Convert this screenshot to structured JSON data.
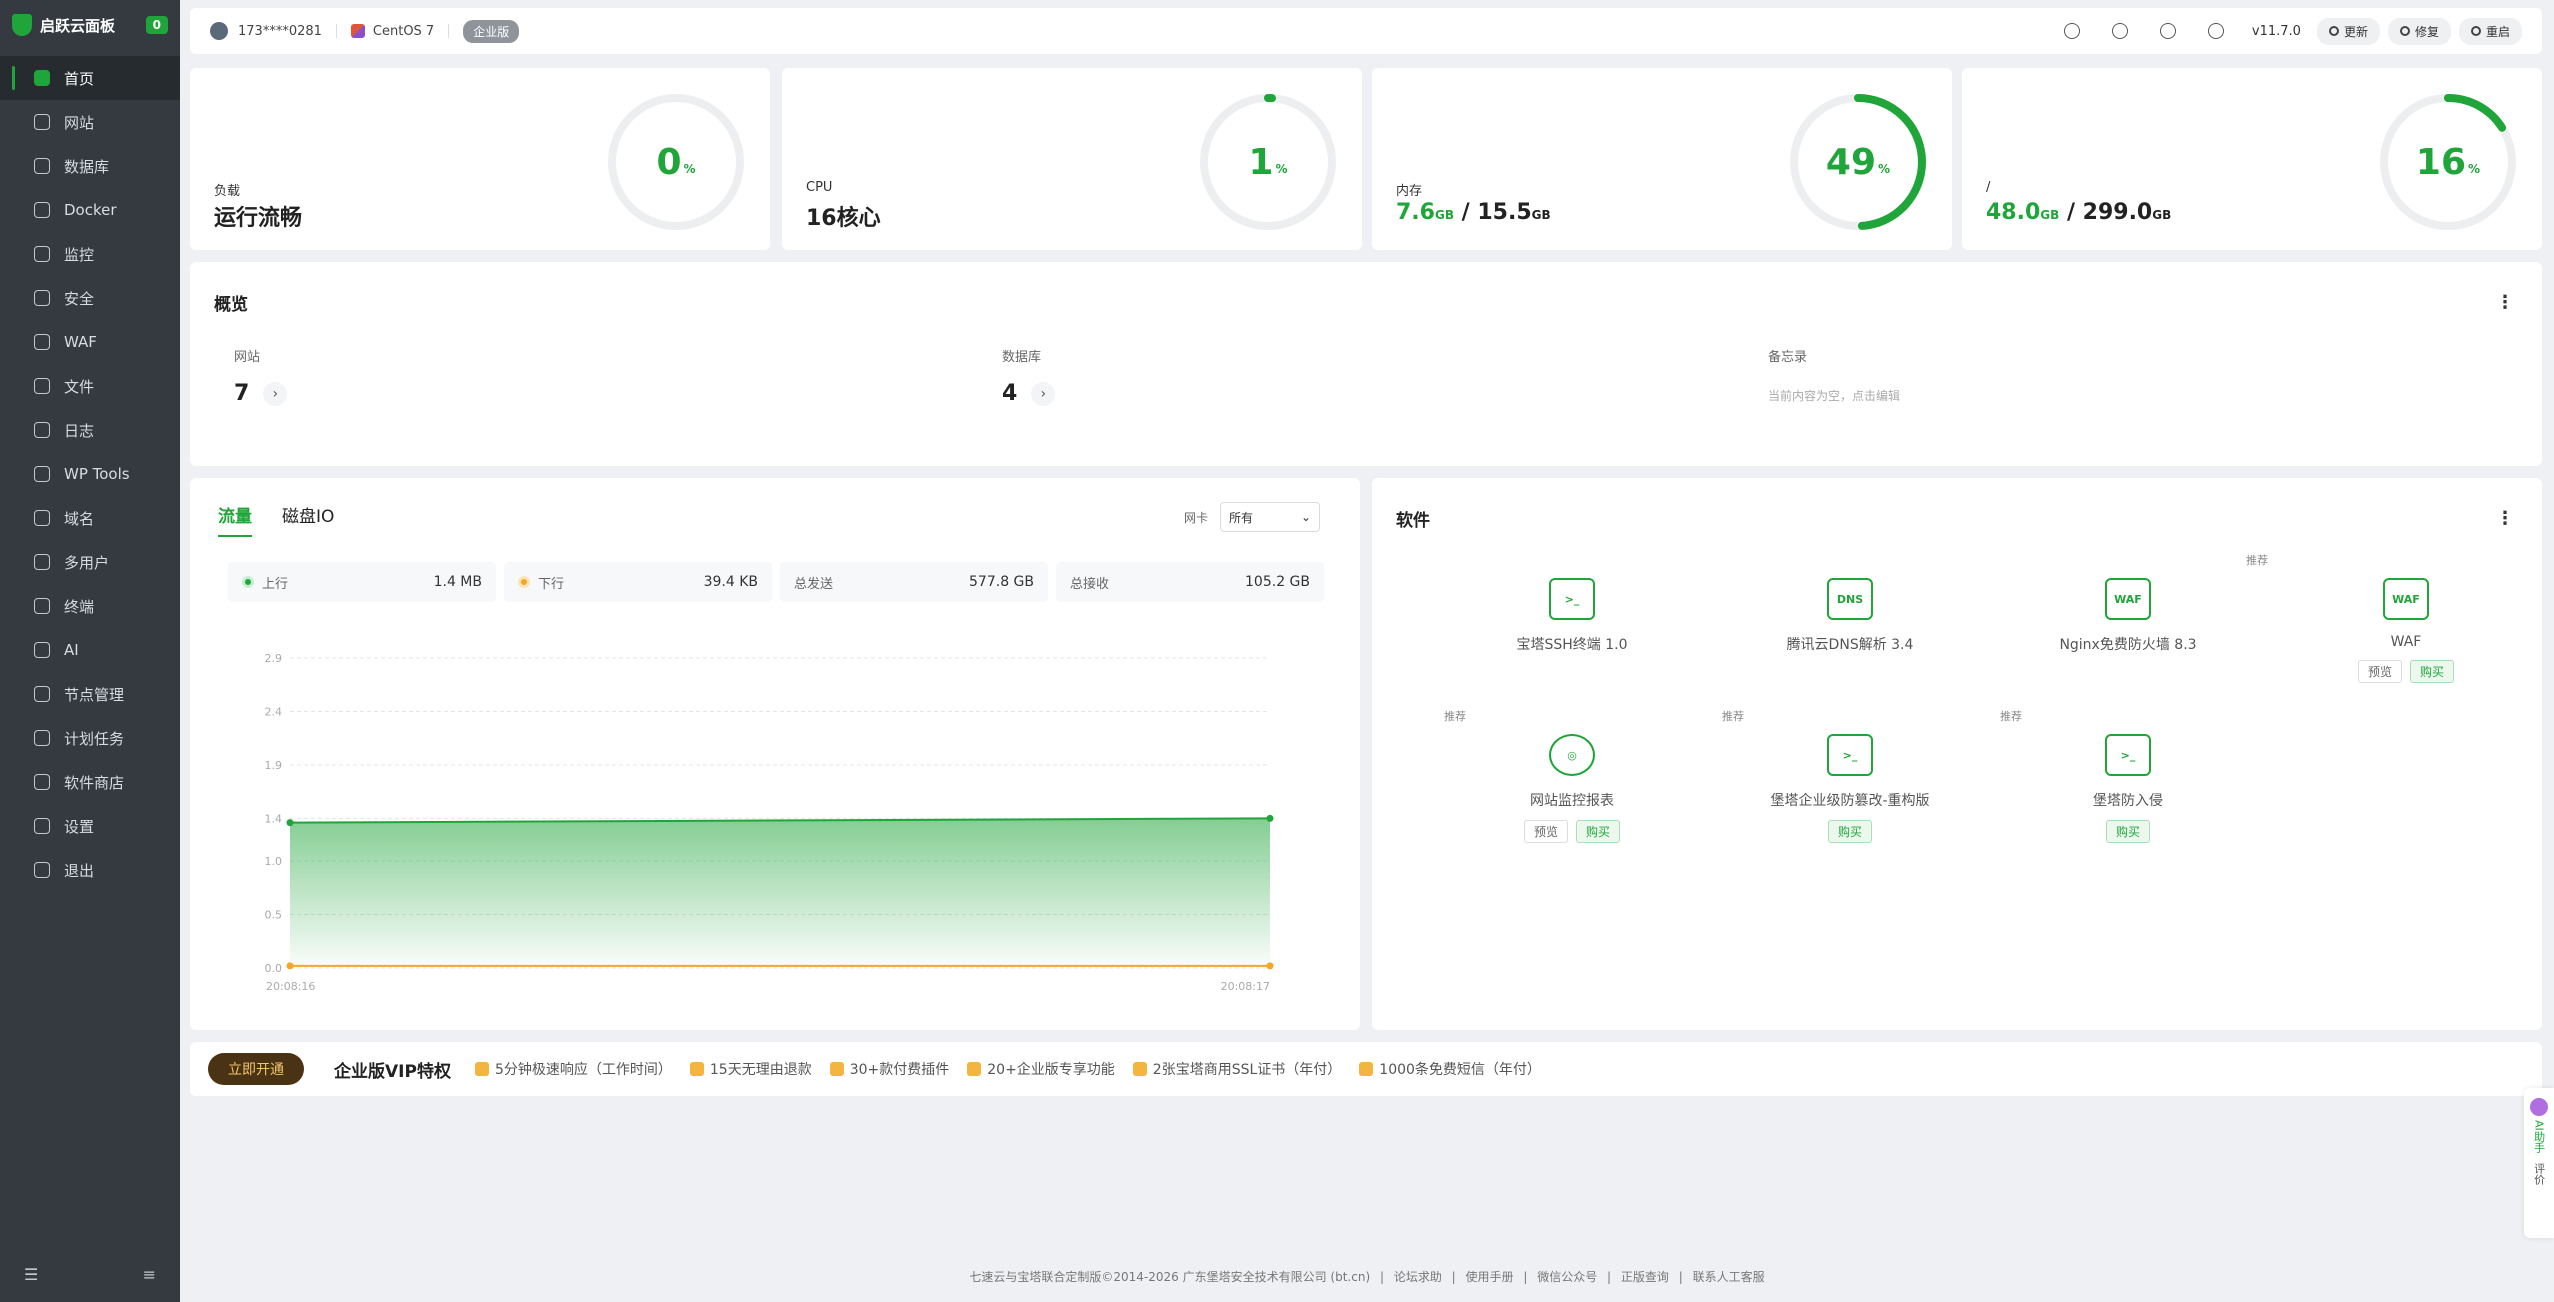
{
  "sidebar": {
    "brand": "启跃云面板",
    "badge": "0",
    "items": [
      {
        "label": "首页",
        "icon": "home-icon",
        "active": true
      },
      {
        "label": "网站",
        "icon": "globe-icon"
      },
      {
        "label": "数据库",
        "icon": "database-icon"
      },
      {
        "label": "Docker",
        "icon": "docker-icon"
      },
      {
        "label": "监控",
        "icon": "monitor-icon"
      },
      {
        "label": "安全",
        "icon": "shield-icon"
      },
      {
        "label": "WAF",
        "icon": "waf-icon"
      },
      {
        "label": "文件",
        "icon": "folder-icon"
      },
      {
        "label": "日志",
        "icon": "log-icon"
      },
      {
        "label": "WP Tools",
        "icon": "wordpress-icon"
      },
      {
        "label": "域名",
        "icon": "domain-icon"
      },
      {
        "label": "多用户",
        "icon": "users-icon"
      },
      {
        "label": "终端",
        "icon": "terminal-icon"
      },
      {
        "label": "AI",
        "icon": "ai-icon"
      },
      {
        "label": "节点管理",
        "icon": "node-icon"
      },
      {
        "label": "计划任务",
        "icon": "calendar-icon"
      },
      {
        "label": "软件商店",
        "icon": "store-icon"
      },
      {
        "label": "设置",
        "icon": "gear-icon"
      },
      {
        "label": "退出",
        "icon": "logout-icon"
      }
    ]
  },
  "topbar": {
    "user": "173****0281",
    "os": "CentOS 7",
    "edition": "企业版",
    "version": "v11.7.0",
    "update": "更新",
    "repair": "修复",
    "restart": "重启"
  },
  "stats": {
    "load": {
      "label": "负载",
      "value": "运行流畅",
      "percent": 0
    },
    "cpu": {
      "label": "CPU",
      "value": "16核心",
      "percent": 1
    },
    "memory": {
      "label": "内存",
      "used": "7.6",
      "total": "15.5",
      "unit": "GB",
      "percent": 49
    },
    "disk": {
      "label": "/",
      "used": "48.0",
      "total": "299.0",
      "unit": "GB",
      "percent": 16
    },
    "pct_symbol": "%",
    "accent": "#20a53a"
  },
  "overview": {
    "title": "概览",
    "sites_label": "网站",
    "sites_count": "7",
    "db_label": "数据库",
    "db_count": "4",
    "memo_label": "备忘录",
    "memo_placeholder": "当前内容为空，点击编辑"
  },
  "traffic": {
    "tabs": [
      "流量",
      "磁盘IO"
    ],
    "nic_label": "网卡",
    "nic_value": "所有",
    "up_label": "上行",
    "up_value": "1.4 MB",
    "down_label": "下行",
    "down_value": "39.4 KB",
    "sent_label": "总发送",
    "sent_value": "577.8 GB",
    "recv_label": "总接收",
    "recv_value": "105.2 GB"
  },
  "chart_data": {
    "type": "area",
    "x": [
      "20:08:16",
      "20:08:17"
    ],
    "series": [
      {
        "name": "上行",
        "values": [
          1.36,
          1.4
        ],
        "color": "#20a53a"
      },
      {
        "name": "下行",
        "values": [
          0.02,
          0.02
        ],
        "color": "#f5a623"
      }
    ],
    "yticks": [
      "0.0",
      "0.5",
      "1.0",
      "1.4",
      "1.9",
      "2.4",
      "2.9"
    ],
    "ylim": [
      0,
      2.9
    ],
    "grid": true
  },
  "software": {
    "title": "软件",
    "recommend": "推荐",
    "preview": "预览",
    "buy": "购买",
    "items": [
      {
        "name": "宝塔SSH终端 1.0",
        "icon": "terminal-icon"
      },
      {
        "name": "腾讯云DNS解析 3.4",
        "icon": "dns-icon",
        "glyph": "DNS"
      },
      {
        "name": "Nginx免费防火墙 8.3",
        "icon": "waf-shield-icon",
        "glyph": "WAF"
      },
      {
        "name": "WAF",
        "icon": "waf-shield-icon",
        "glyph": "WAF"
      },
      {
        "name": "网站监控报表",
        "icon": "target-icon"
      },
      {
        "name": "堡塔企业级防篡改-重构版",
        "icon": "lock-window-icon"
      },
      {
        "name": "堡塔防入侵",
        "icon": "lock-terminal-icon"
      }
    ]
  },
  "vip": {
    "open": "立即开通",
    "title": "企业版VIP特权",
    "features": [
      "5分钟极速响应（工作时间）",
      "15天无理由退款",
      "30+款付费插件",
      "20+企业版专享功能",
      "2张宝塔商用SSL证书（年付）",
      "1000条免费短信（年付）"
    ]
  },
  "footer": {
    "copyright": "七速云与宝塔联合定制版©2014-2026 广东堡塔安全技术有限公司 (bt.cn)",
    "links": [
      "论坛求助",
      "使用手册",
      "微信公众号",
      "正版查询",
      "联系人工客服"
    ]
  },
  "float": {
    "ai": "AI助手",
    "rate": "评价"
  }
}
